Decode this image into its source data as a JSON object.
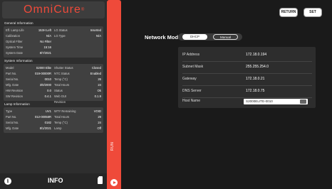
{
  "app": {
    "logo": "OmniCure",
    "logo_mark": "®"
  },
  "general": {
    "title": "General Information",
    "rows": [
      {
        "k1": "Eff. Lamp Life",
        "v1": "153H Left",
        "k2": "LG Status",
        "v2": "Inserted"
      },
      {
        "k1": "Calibration",
        "v1": "N/A",
        "k2": "LG Type",
        "v2": "N/A"
      },
      {
        "k1": "Optical Filter",
        "v1": "No Filter",
        "k2": "",
        "v2": ""
      },
      {
        "k1": "System Time",
        "v1": "15:16",
        "k2": "",
        "v2": ""
      },
      {
        "k1": "System Date",
        "v1": "8/7/2021",
        "k2": "",
        "v2": ""
      }
    ]
  },
  "system": {
    "title": "System Information",
    "rows": [
      {
        "k1": "Model",
        "v1": "S2000 Elite",
        "k2": "Shutter Status",
        "v2": "Closed"
      },
      {
        "k1": "Part No.",
        "v1": "019-00000R",
        "k2": "NTC Status",
        "v2": "Enabled"
      },
      {
        "k1": "Serial No.",
        "v1": "0010",
        "k2": "Temp (°C)",
        "v2": "26"
      },
      {
        "k1": "Mfg. Date",
        "v1": "3/0/2000",
        "k2": "Total Hours",
        "v2": "24"
      },
      {
        "k1": "HW Revision",
        "v1": "0.0",
        "k2": "Status",
        "v2": "Ok"
      },
      {
        "k1": "SW Revision",
        "v1": "0.4.1",
        "k2": "Web GUI Revision",
        "v2": "0.1.9"
      }
    ]
  },
  "lamp": {
    "title": "Lamp Information",
    "rows": [
      {
        "k1": "Type",
        "v1": "UV1",
        "k2": "WTY Remaining",
        "v2": "VOID"
      },
      {
        "k1": "Part No.",
        "v1": "012-00058R",
        "k2": "Total Hours",
        "v2": "29"
      },
      {
        "k1": "Serial No.",
        "v1": "0182",
        "k2": "Temp (°C)",
        "v2": "24"
      },
      {
        "k1": "Mfg. Date",
        "v1": "8/1/2021",
        "k2": "Lamp",
        "v2": "Off"
      }
    ]
  },
  "footer": {
    "info_label": "INFO",
    "info_icon": "i"
  },
  "run": {
    "label": "RUN"
  },
  "top_buttons": {
    "return_label": "RETURN",
    "set_label": "SET"
  },
  "network": {
    "mode_label": "Network Mode",
    "options": {
      "dhcp": "DHCP",
      "manual": "Manual"
    },
    "selected": "DHCP",
    "ip": {
      "label": "IP Address",
      "value": "172.18.0.194"
    },
    "mask": {
      "label": "Subnet Mask",
      "value": "255.255.254.0"
    },
    "gateway": {
      "label": "Gateway",
      "value": "172.18.0.21"
    },
    "dns": {
      "label": "DNS Server",
      "value": "172.18.0.75"
    },
    "host": {
      "label": "Host Name",
      "value": "S2000ELITE-0010"
    }
  },
  "colors": {
    "accent": "#ef4a3a",
    "panel": "#2e2e2e",
    "background": "#1a1a1a"
  },
  "icons": [
    "info-icon",
    "sd-card-icon",
    "play-icon",
    "keyboard-icon"
  ]
}
